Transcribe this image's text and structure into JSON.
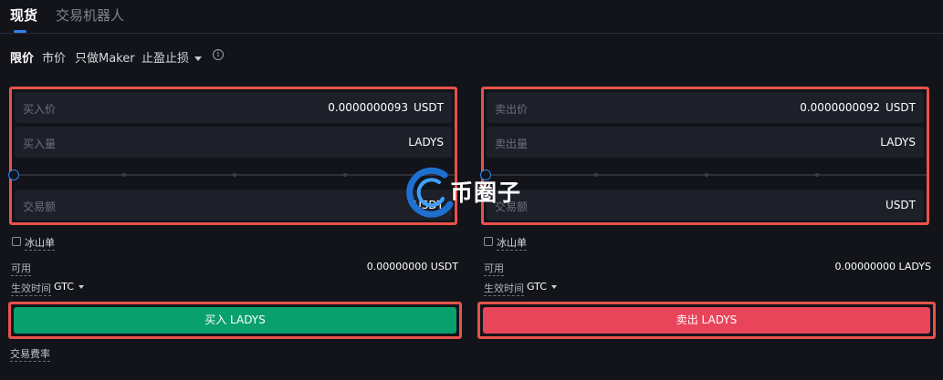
{
  "tabs": {
    "spot": "现货",
    "bot": "交易机器人"
  },
  "order_types": {
    "limit": "限价",
    "market": "市价",
    "maker_only": "只做Maker",
    "tp_sl": "止盈止损",
    "info": "i"
  },
  "buy": {
    "price_label": "买入价",
    "price_value": "0.0000000093",
    "price_unit": "USDT",
    "amount_label": "买入量",
    "amount_unit": "LADYS",
    "total_label": "交易额",
    "total_unit": "USDT",
    "iceberg_label": "冰山单",
    "available_label": "可用",
    "available_value": "0.00000000 USDT",
    "tif_label": "生效时间",
    "tif_value": "GTC",
    "button_label": "买入 LADYS"
  },
  "sell": {
    "price_label": "卖出价",
    "price_value": "0.0000000092",
    "price_unit": "USDT",
    "amount_label": "卖出量",
    "amount_unit": "LADYS",
    "total_label": "交易额",
    "total_unit": "USDT",
    "iceberg_label": "冰山单",
    "available_label": "可用",
    "available_value": "0.00000000 LADYS",
    "tif_label": "生效时间",
    "tif_value": "GTC",
    "button_label": "卖出 LADYS"
  },
  "fee_label": "交易费率",
  "watermark_text": "币圈子",
  "colors": {
    "accent": "#2f7ff0",
    "buy": "#0aa06e",
    "sell": "#e8455a",
    "highlight": "#e8524a",
    "background": "#12141a"
  },
  "icons": {
    "info": "info-icon",
    "dropdown": "chevron-down-icon",
    "checkbox": "checkbox-icon",
    "watermark_logo": "logo-icon"
  }
}
